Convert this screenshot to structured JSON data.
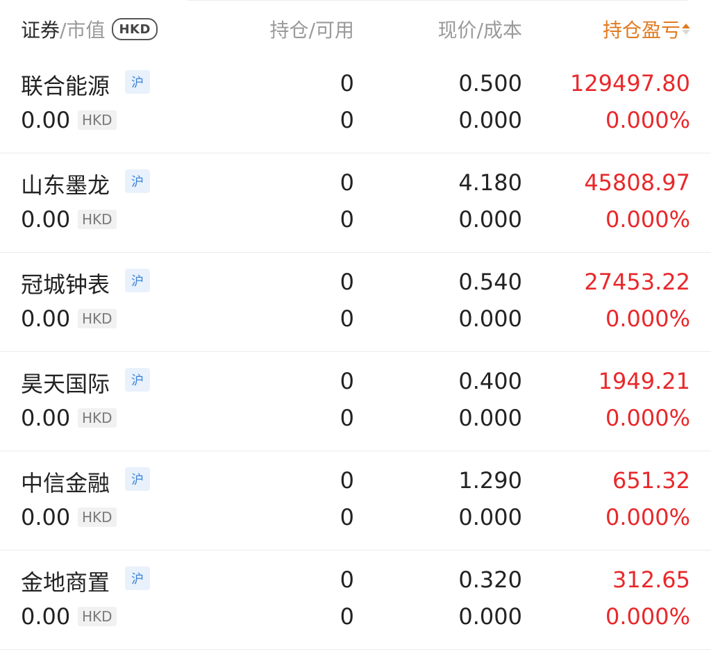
{
  "header": {
    "security_main": "证券",
    "security_sub": "/市值",
    "currency_badge": "HKD",
    "position_main": "持仓",
    "position_sub": "/可用",
    "price_main": "现价",
    "price_sub": "/成本",
    "pl_label": "持仓盈亏"
  },
  "colors": {
    "profit": "#e8282b",
    "sort_active": "#e07a1f",
    "market_badge": "#3b82d6"
  },
  "rows": [
    {
      "name": "联合能源",
      "market": "沪",
      "market_value": "0.00",
      "currency": "HKD",
      "position": "0",
      "available": "0",
      "price": "0.500",
      "cost": "0.000",
      "pl": "129497.80",
      "pl_pct": "0.000%"
    },
    {
      "name": "山东墨龙",
      "market": "沪",
      "market_value": "0.00",
      "currency": "HKD",
      "position": "0",
      "available": "0",
      "price": "4.180",
      "cost": "0.000",
      "pl": "45808.97",
      "pl_pct": "0.000%"
    },
    {
      "name": "冠城钟表",
      "market": "沪",
      "market_value": "0.00",
      "currency": "HKD",
      "position": "0",
      "available": "0",
      "price": "0.540",
      "cost": "0.000",
      "pl": "27453.22",
      "pl_pct": "0.000%"
    },
    {
      "name": "昊天国际",
      "market": "沪",
      "market_value": "0.00",
      "currency": "HKD",
      "position": "0",
      "available": "0",
      "price": "0.400",
      "cost": "0.000",
      "pl": "1949.21",
      "pl_pct": "0.000%"
    },
    {
      "name": "中信金融",
      "market": "沪",
      "market_value": "0.00",
      "currency": "HKD",
      "position": "0",
      "available": "0",
      "price": "1.290",
      "cost": "0.000",
      "pl": "651.32",
      "pl_pct": "0.000%"
    },
    {
      "name": "金地商置",
      "market": "沪",
      "market_value": "0.00",
      "currency": "HKD",
      "position": "0",
      "available": "0",
      "price": "0.320",
      "cost": "0.000",
      "pl": "312.65",
      "pl_pct": "0.000%"
    }
  ]
}
